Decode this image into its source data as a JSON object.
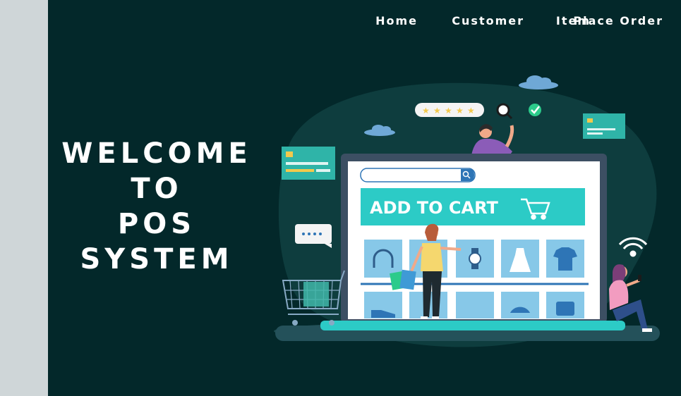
{
  "nav": {
    "home": "Home",
    "customer": "Customer",
    "item": "Item",
    "place_order": "Place Order"
  },
  "welcome": {
    "line1": "WELCOME",
    "line2": "TO",
    "line3": "POS",
    "line4": "SYSTEM"
  },
  "illustration": {
    "banner_text": "ADD TO CART",
    "rating_stars": 5
  },
  "colors": {
    "background": "#03282a",
    "side_strip": "#cfd6d8",
    "accent_teal": "#2ccbc6",
    "text": "#ffffff"
  }
}
